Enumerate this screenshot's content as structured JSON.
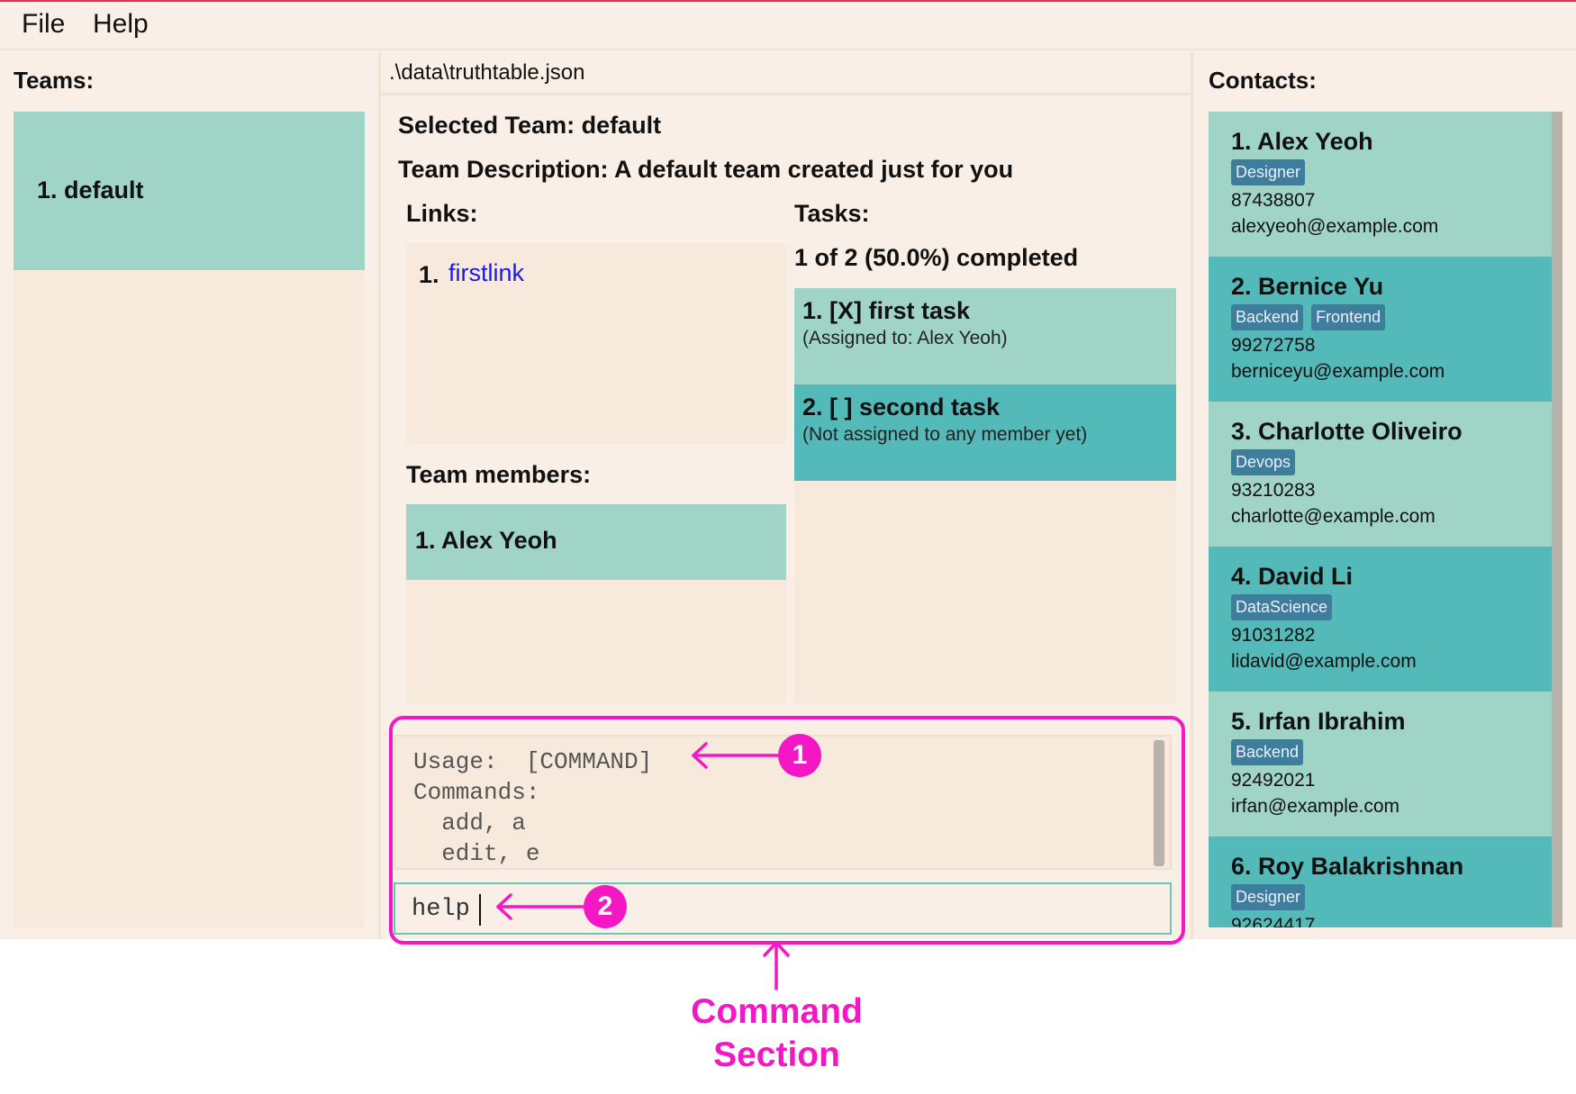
{
  "menu": {
    "file": "File",
    "help": "Help"
  },
  "teams": {
    "title": "Teams:",
    "items": [
      {
        "label": "1. default"
      }
    ]
  },
  "center": {
    "file_path": ".\\data\\truthtable.json",
    "selected_team": "Selected Team: default",
    "team_description": "Team Description: A default team created just for you",
    "links_title": "Links:",
    "links": [
      {
        "number": "1.",
        "text": "firstlink"
      }
    ],
    "members_title": "Team members:",
    "members": [
      {
        "label": "1. Alex Yeoh"
      }
    ],
    "tasks_title": "Tasks:",
    "tasks_progress": "1 of 2 (50.0%) completed",
    "tasks": [
      {
        "title": "1. [X] first task",
        "subtitle": "(Assigned to: Alex Yeoh)",
        "color": "#9fd4c7"
      },
      {
        "title": "2. [ ] second task",
        "subtitle": "(Not assigned to any member yet)",
        "color": "#54b9b9"
      }
    ]
  },
  "command": {
    "result_lines": [
      "Usage:  [COMMAND]",
      "Commands:",
      "  add, a",
      "  edit, e"
    ],
    "input_value": "help"
  },
  "contacts": {
    "title": "Contacts:",
    "items": [
      {
        "name": "1. Alex Yeoh",
        "tags": [
          "Designer"
        ],
        "phone": "87438807",
        "email": "alexyeoh@example.com",
        "color": "#9fd4c7"
      },
      {
        "name": "2. Bernice Yu",
        "tags": [
          "Backend",
          "Frontend"
        ],
        "phone": "99272758",
        "email": "berniceyu@example.com",
        "color": "#54b9b9"
      },
      {
        "name": "3. Charlotte Oliveiro",
        "tags": [
          "Devops"
        ],
        "phone": "93210283",
        "email": "charlotte@example.com",
        "color": "#9fd4c7"
      },
      {
        "name": "4. David Li",
        "tags": [
          "DataScience"
        ],
        "phone": "91031282",
        "email": "lidavid@example.com",
        "color": "#54b9b9"
      },
      {
        "name": "5. Irfan Ibrahim",
        "tags": [
          "Backend"
        ],
        "phone": "92492021",
        "email": "irfan@example.com",
        "color": "#9fd4c7"
      },
      {
        "name": "6. Roy Balakrishnan",
        "tags": [
          "Designer"
        ],
        "phone": "92624417",
        "email": "",
        "color": "#54b9b9"
      }
    ]
  },
  "annotation": {
    "badge_1": "1",
    "badge_2": "2",
    "caption_line1": "Command",
    "caption_line2": "Section",
    "color": "#f318c3"
  }
}
